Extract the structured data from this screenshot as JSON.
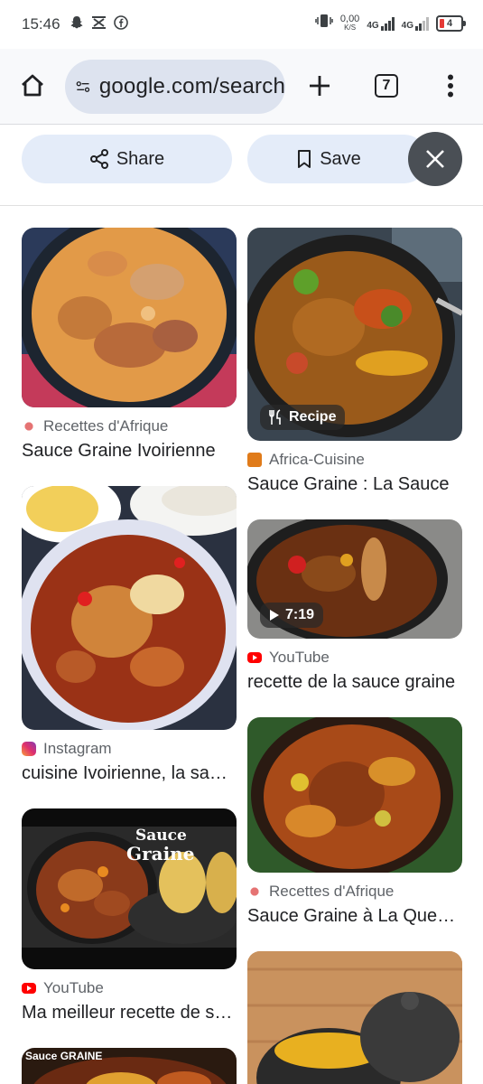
{
  "status_bar": {
    "time": "15:46",
    "net_speed_top": "0,00",
    "net_speed_unit": "K/S",
    "network_1": "4G",
    "network_2": "4G",
    "battery": "4"
  },
  "toolbar": {
    "url": "google.com/search",
    "tab_count": "7"
  },
  "actions": {
    "share_label": "Share",
    "save_label": "Save"
  },
  "results": {
    "left": [
      {
        "source": "Recettes d'Afrique",
        "title": "Sauce Graine Ivoirienne",
        "favicon": "recettes-afrique-icon"
      },
      {
        "source": "Instagram",
        "title": "cuisine Ivoirienne, la sauce graine",
        "favicon": "instagram-icon"
      },
      {
        "source": "YouTube",
        "title": "Ma meilleur recette de sauce graine",
        "favicon": "youtube-icon",
        "thumb_text_1": "Sauce",
        "thumb_text_2": "Graine"
      },
      {
        "thumb_text": "Sauce GRAINE"
      }
    ],
    "right": [
      {
        "source": "Africa-Cuisine",
        "title": "Sauce Graine : La Sauce",
        "favicon": "africa-cuisine-icon",
        "badge": "Recipe"
      },
      {
        "source": "YouTube",
        "title": "recette de la sauce graine",
        "favicon": "youtube-icon",
        "badge": "7:19"
      },
      {
        "source": "Recettes d'Afrique",
        "title": "Sauce Graine à La Queue de Bœuf",
        "favicon": "recettes-afrique-icon"
      },
      {}
    ]
  },
  "colors": {
    "accent_pill": "#e4ecf9",
    "omnibox": "#dde3ef",
    "youtube_red": "#ff0000",
    "battery_low": "#e53935"
  }
}
